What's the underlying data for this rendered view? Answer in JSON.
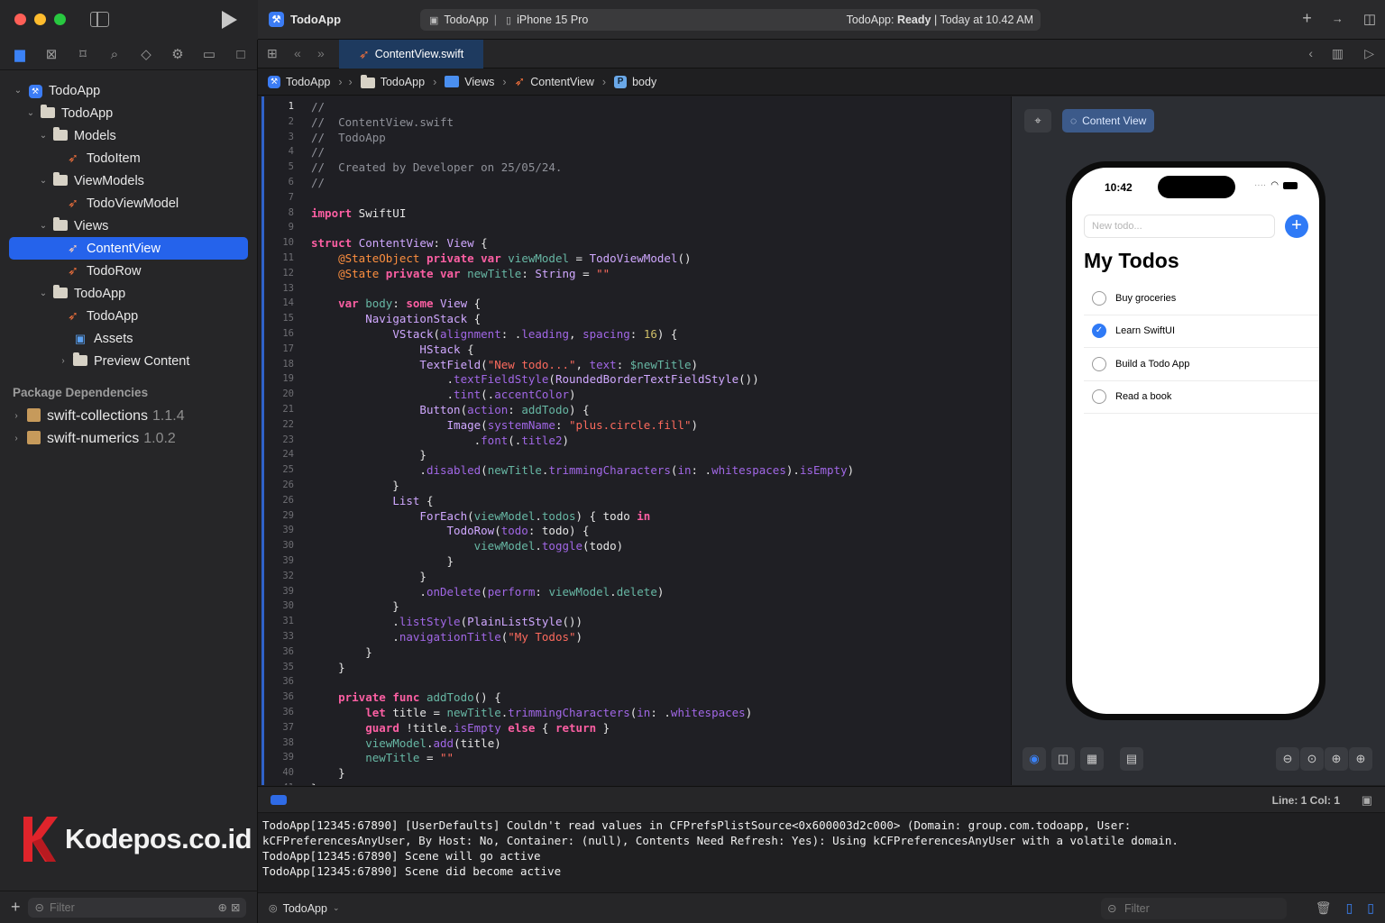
{
  "window": {
    "app_title": "TodoApp",
    "scheme": "TodoApp",
    "device": "iPhone 15 Pro",
    "status_prefix": "TodoApp: ",
    "status_state": "Ready",
    "status_suffix": " | Today at 10.42 AM",
    "colors": {
      "accent": "#2563eb",
      "swift_orange": "#f0703c",
      "close": "#ff5f57",
      "minimize": "#febc2e",
      "zoom": "#28c840"
    }
  },
  "editor_tab": {
    "label": "ContentView.swift"
  },
  "breadcrumb": [
    "TodoApp",
    "TodoApp",
    "Views",
    "ContentView",
    "body"
  ],
  "sidebar": {
    "tree": [
      {
        "label": "TodoApp",
        "kind": "project",
        "depth": 0,
        "chevron": "down"
      },
      {
        "label": "TodoApp",
        "kind": "folder",
        "depth": 1,
        "chevron": "down"
      },
      {
        "label": "Models",
        "kind": "folder",
        "depth": 2,
        "chevron": "down"
      },
      {
        "label": "TodoItem",
        "kind": "swift",
        "depth": 3
      },
      {
        "label": "ViewModels",
        "kind": "folder",
        "depth": 2,
        "chevron": "down"
      },
      {
        "label": "TodoViewModel",
        "kind": "swift",
        "depth": 3
      },
      {
        "label": "Views",
        "kind": "folder",
        "depth": 2,
        "chevron": "down"
      },
      {
        "label": "ContentView",
        "kind": "swift",
        "depth": 3,
        "selected": true
      },
      {
        "label": "TodoRow",
        "kind": "swift",
        "depth": 3
      },
      {
        "label": "TodoApp",
        "kind": "folder",
        "depth": 2,
        "chevron": "down"
      },
      {
        "label": "TodoApp",
        "kind": "swift",
        "depth": 3
      },
      {
        "label": "Assets",
        "kind": "assets",
        "depth": 3
      },
      {
        "label": "Preview Content",
        "kind": "folder",
        "depth": 3,
        "chevron": "right"
      }
    ],
    "packages_title": "Package Dependencies",
    "packages": [
      {
        "name": "swift-collections",
        "version": "1.1.4"
      },
      {
        "name": "swift-numerics",
        "version": "1.0.2"
      }
    ],
    "filter_placeholder": "Filter",
    "watermark": "Kodepos.co.id"
  },
  "code_lines": [
    {
      "n": "1",
      "html": "<span class=\"c-cmt\">//</span>"
    },
    {
      "n": "2",
      "html": "<span class=\"c-cmt\">//  ContentView.swift</span>"
    },
    {
      "n": "3",
      "html": "<span class=\"c-cmt\">//  TodoApp</span>"
    },
    {
      "n": "4",
      "html": "<span class=\"c-cmt\">//</span>"
    },
    {
      "n": "5",
      "html": "<span class=\"c-cmt\">//  Created by Developer on 25/05/24.</span>"
    },
    {
      "n": "6",
      "html": "<span class=\"c-cmt\">//</span>"
    },
    {
      "n": "7",
      "html": ""
    },
    {
      "n": "8",
      "html": "<span class=\"c-kw\">import</span> SwiftUI"
    },
    {
      "n": "9",
      "html": ""
    },
    {
      "n": "10",
      "html": "<span class=\"c-kw\">struct</span> <span class=\"c-type\">ContentView</span>: <span class=\"c-type\">View</span> {"
    },
    {
      "n": "11",
      "html": "    <span class=\"c-attr\">@StateObject</span> <span class=\"c-kw\">private var</span> <span class=\"c-prop\">viewModel</span> = <span class=\"c-type\">TodoViewModel</span>()"
    },
    {
      "n": "12",
      "html": "    <span class=\"c-attr\">@State</span> <span class=\"c-kw\">private var</span> <span class=\"c-prop\">newTitle</span>: <span class=\"c-type\">String</span> = <span class=\"c-str\">\"\"</span>"
    },
    {
      "n": "13",
      "html": ""
    },
    {
      "n": "14",
      "html": "    <span class=\"c-kw\">var</span> <span class=\"c-prop\">body</span>: <span class=\"c-kw\">some</span> <span class=\"c-type\">View</span> {"
    },
    {
      "n": "15",
      "html": "        <span class=\"c-type\">NavigationStack</span> {"
    },
    {
      "n": "16",
      "html": "            <span class=\"c-type\">VStack</span>(<span class=\"c-fn\">alignment</span>: .<span class=\"c-fn\">leading</span>, <span class=\"c-fn\">spacing</span>: <span class=\"c-num\">16</span>) {"
    },
    {
      "n": "17",
      "html": "                <span class=\"c-type\">HStack</span> {"
    },
    {
      "n": "18",
      "html": "                <span class=\"c-type\">TextField</span>(<span class=\"c-str\">\"New todo...\"</span>, <span class=\"c-fn\">text</span>: <span class=\"c-prop\">$newTitle</span>)"
    },
    {
      "n": "19",
      "html": "                    .<span class=\"c-fn\">textFieldStyle</span>(<span class=\"c-type\">RoundedBorderTextFieldStyle</span>())"
    },
    {
      "n": "20",
      "html": "                    .<span class=\"c-fn\">tint</span>(.<span class=\"c-fn\">accentColor</span>)"
    },
    {
      "n": "21",
      "html": "                <span class=\"c-type\">Button</span>(<span class=\"c-fn\">action</span>: <span class=\"c-prop\">addTodo</span>) {"
    },
    {
      "n": "22",
      "html": "                    <span class=\"c-type\">Image</span>(<span class=\"c-fn\">systemName</span>: <span class=\"c-str\">\"plus.circle.fill\"</span>)"
    },
    {
      "n": "23",
      "html": "                        .<span class=\"c-fn\">font</span>(.<span class=\"c-fn\">title2</span>)"
    },
    {
      "n": "24",
      "html": "                }"
    },
    {
      "n": "25",
      "html": "                .<span class=\"c-fn\">disabled</span>(<span class=\"c-prop\">newTitle</span>.<span class=\"c-fn\">trimmingCharacters</span>(<span class=\"c-fn\">in</span>: .<span class=\"c-fn\">whitespaces</span>).<span class=\"c-fn\">isEmpty</span>)"
    },
    {
      "n": "26",
      "html": "            }"
    },
    {
      "n": "26",
      "html": "            <span class=\"c-type\">List</span> {"
    },
    {
      "n": "29",
      "html": "                <span class=\"c-type\">ForEach</span>(<span class=\"c-prop\">viewModel</span>.<span class=\"c-prop\">todos</span>) { todo <span class=\"c-kw\">in</span>"
    },
    {
      "n": "39",
      "html": "                    <span class=\"c-type\">TodoRow</span>(<span class=\"c-fn\">todo</span>: todo) {"
    },
    {
      "n": "30",
      "html": "                        <span class=\"c-prop\">viewModel</span>.<span class=\"c-fn\">toggle</span>(todo)"
    },
    {
      "n": "39",
      "html": "                    }"
    },
    {
      "n": "32",
      "html": "                }"
    },
    {
      "n": "39",
      "html": "                .<span class=\"c-fn\">onDelete</span>(<span class=\"c-fn\">perform</span>: <span class=\"c-prop\">viewModel</span>.<span class=\"c-prop\">delete</span>)"
    },
    {
      "n": "30",
      "html": "            }"
    },
    {
      "n": "31",
      "html": "            .<span class=\"c-fn\">listStyle</span>(<span class=\"c-type\">PlainListStyle</span>())"
    },
    {
      "n": "33",
      "html": "            .<span class=\"c-fn\">navigationTitle</span>(<span class=\"c-str\">\"My Todos\"</span>)"
    },
    {
      "n": "36",
      "html": "        }"
    },
    {
      "n": "35",
      "html": "    }"
    },
    {
      "n": "36",
      "html": ""
    },
    {
      "n": "36",
      "html": "    <span class=\"c-kw\">private func</span> <span class=\"c-prop\">addTodo</span>() {"
    },
    {
      "n": "36",
      "html": "        <span class=\"c-kw\">let</span> title = <span class=\"c-prop\">newTitle</span>.<span class=\"c-fn\">trimmingCharacters</span>(<span class=\"c-fn\">in</span>: .<span class=\"c-fn\">whitespaces</span>)"
    },
    {
      "n": "37",
      "html": "        <span class=\"c-kw\">guard</span> !title.<span class=\"c-fn\">isEmpty</span> <span class=\"c-kw\">else</span> { <span class=\"c-kw\">return</span> }"
    },
    {
      "n": "38",
      "html": "        <span class=\"c-prop\">viewModel</span>.<span class=\"c-fn\">add</span>(title)"
    },
    {
      "n": "39",
      "html": "        <span class=\"c-prop\">newTitle</span> = <span class=\"c-str\">\"\"</span>"
    },
    {
      "n": "40",
      "html": "    }"
    },
    {
      "n": "41",
      "html": "}"
    }
  ],
  "preview": {
    "label": "Content View",
    "time": "10:42",
    "input_placeholder": "New todo...",
    "title": "My Todos",
    "todos": [
      {
        "title": "Buy groceries",
        "done": false
      },
      {
        "title": "Learn SwiftUI",
        "done": true
      },
      {
        "title": "Build a Todo App",
        "done": false
      },
      {
        "title": "Read a book",
        "done": false
      }
    ]
  },
  "debug": {
    "line_col": "Line: 1  Col: 1",
    "console": [
      "TodoApp[12345:67890] [UserDefaults] Couldn't read values in CFPrefsPlistSource<0x600003d2c000> (Domain: group.com.todoapp, User:",
      "kCFPreferencesAnyUser, By Host: No, Container: (null), Contents Need Refresh: Yes): Using kCFPreferencesAnyUser with a volatile domain.",
      "TodoApp[12345:67890] Scene will go active",
      "TodoApp[12345:67890] Scene did become active"
    ],
    "target": "TodoApp",
    "filter_placeholder": "Filter"
  }
}
